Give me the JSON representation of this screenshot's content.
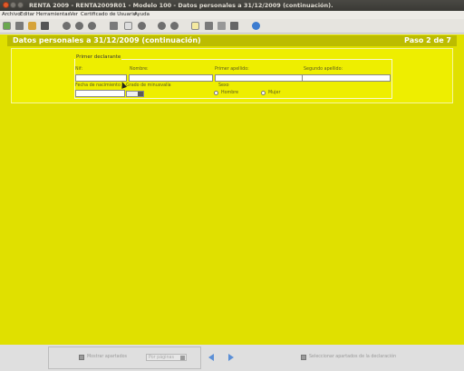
{
  "window": {
    "title": "RENTA 2009 - RENTA2009R01 - Modelo 100 - Datos personales a 31/12/2009 (continuación)."
  },
  "menu": [
    "Archivo",
    "Editar",
    "Herramientas",
    "Ver",
    "Certificado de Usuario",
    "Ayuda"
  ],
  "toolbar_icons": [
    "app-icon",
    "print-icon",
    "folder-icon",
    "save-icon",
    "gray-circle-icon",
    "gray-circle-icon",
    "gray-circle-icon",
    "calculator-icon",
    "page-icon",
    "gray-circle-icon",
    "gray-circle-icon",
    "edit-icon",
    "grid-icon",
    "table-icon",
    "book-icon",
    "help-icon"
  ],
  "header": {
    "title": "Datos personales a 31/12/2009 (continuación)",
    "step": "Paso 2 de 7"
  },
  "form": {
    "legend": "Primer declarante",
    "nif_label": "Nif:",
    "nombre_label": "Nombre:",
    "apellido1_label": "Primer apellido:",
    "apellido2_label": "Segundo apellido:",
    "fecha_label": "Fecha de nacimiento",
    "minusvalia_label": "Grado de minusvalía",
    "sexo_label": "Sexo",
    "hombre_label": "Hombre",
    "mujer_label": "Mujer",
    "nif_value": "",
    "nombre_value": "",
    "apellido1_value": "",
    "apellido2_value": "",
    "fecha_value": "",
    "minusvalia_value": ""
  },
  "bottom": {
    "mostrar_label": "Mostrar apartados",
    "por_paginas": "Por páginas",
    "seleccionar_label": "Seleccionar apartados de la declaración"
  },
  "colors": {
    "content_bg": "#e0e000",
    "header_bg": "#bcbc00",
    "panel_bg": "#eeee00"
  }
}
